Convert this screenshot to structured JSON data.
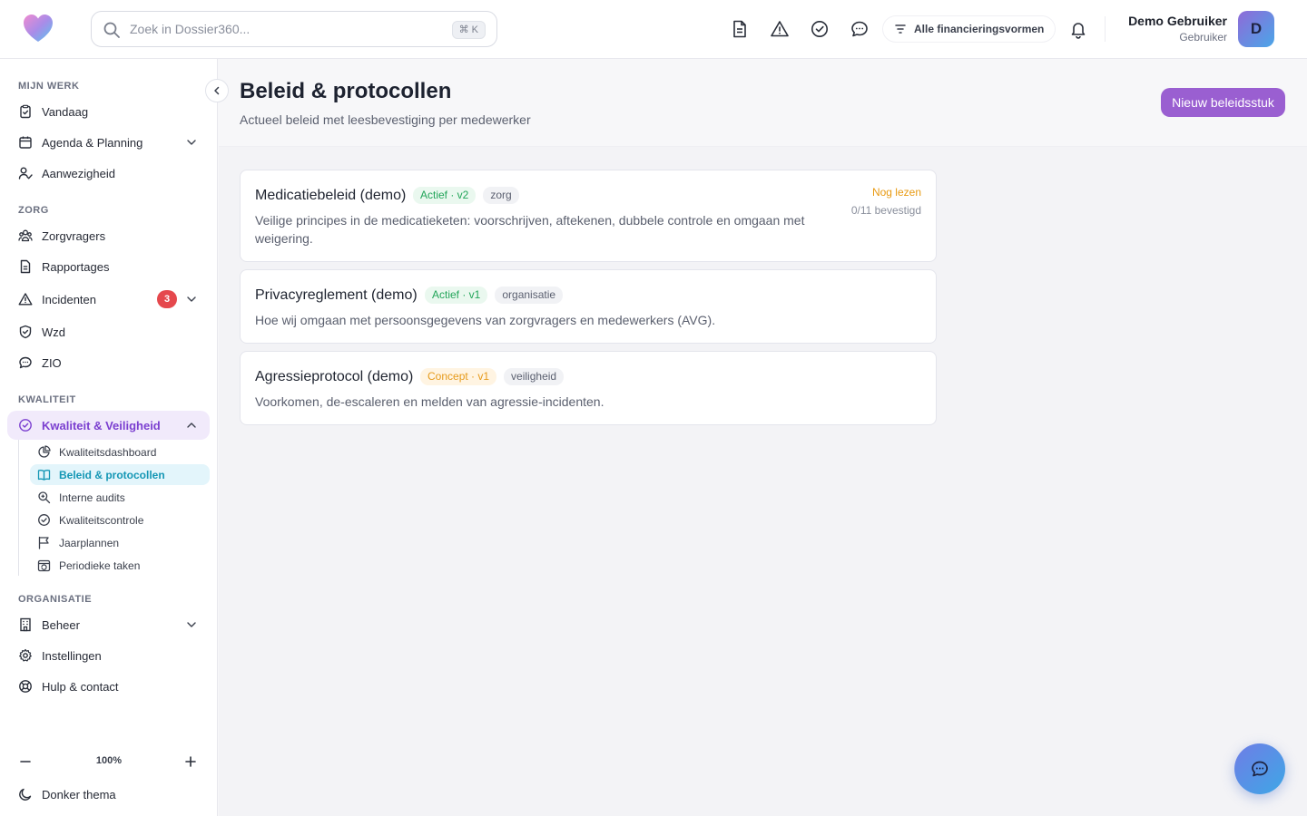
{
  "search": {
    "placeholder": "Zoek in Dossier360...",
    "shortcut": "⌘ K"
  },
  "topbar": {
    "financing_label": "Alle financieringsvormen"
  },
  "user": {
    "name": "Demo Gebruiker",
    "role": "Gebruiker",
    "initial": "D"
  },
  "sidebar": {
    "sections": {
      "mijn_werk": "MIJN WERK",
      "zorg": "ZORG",
      "kwaliteit": "KWALITEIT",
      "organisatie": "ORGANISATIE"
    },
    "items": {
      "vandaag": "Vandaag",
      "agenda": "Agenda & Planning",
      "aanwezigheid": "Aanwezigheid",
      "zorgvragers": "Zorgvragers",
      "rapportages": "Rapportages",
      "incidenten": "Incidenten",
      "incidenten_badge": "3",
      "wzd": "Wzd",
      "zio": "ZIO",
      "kwaliteit_veiligheid": "Kwaliteit & Veiligheid",
      "beheer": "Beheer",
      "instellingen": "Instellingen",
      "hulp": "Hulp & contact"
    },
    "sub_items": {
      "kwaliteitsdashboard": "Kwaliteitsdashboard",
      "beleid": "Beleid & protocollen",
      "audits": "Interne audits",
      "kwaliteitscontrole": "Kwaliteitscontrole",
      "jaarplannen": "Jaarplannen",
      "periodieke": "Periodieke taken"
    },
    "zoom": "100%",
    "dark_theme": "Donker thema"
  },
  "page": {
    "title": "Beleid & protocollen",
    "subtitle": "Actueel beleid met leesbevestiging per medewerker",
    "new_button": "Nieuw beleidsstuk"
  },
  "policies": [
    {
      "title": "Medicatiebeleid (demo)",
      "status_tag": "Actief · v2",
      "category": "zorg",
      "description": "Veilige principes in de medicatieketen: voorschrijven, aftekenen, dubbele controle en omgaan met weigering.",
      "read_status": "Nog lezen",
      "confirmed": "0/11 bevestigd"
    },
    {
      "title": "Privacyreglement (demo)",
      "status_tag": "Actief · v1",
      "category": "organisatie",
      "description": "Hoe wij omgaan met persoonsgegevens van zorgvragers en medewerkers (AVG)."
    },
    {
      "title": "Agressieprotocol (demo)",
      "status_tag": "Concept · v1",
      "category": "veiligheid",
      "description": "Voorkomen, de-escaleren en melden van agressie-incidenten."
    }
  ],
  "colors": {
    "accent_purple": "#9a5fd1",
    "active_teal": "#1597b5",
    "badge_red": "#e5484d",
    "status_green": "#22a559",
    "status_orange": "#e69a1a"
  },
  "icons": {
    "logo": "heart-logo-icon",
    "search": "search-icon",
    "document": "document-icon",
    "warning": "warning-icon",
    "check": "check-circle-icon",
    "chat": "chat-icon",
    "filter": "filter-icon",
    "bell": "bell-icon"
  }
}
